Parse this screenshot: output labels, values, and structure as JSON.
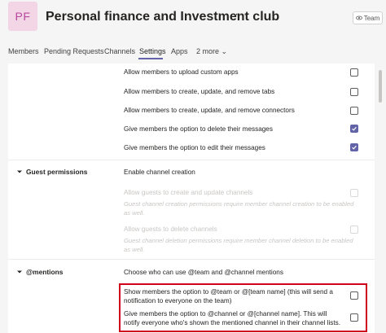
{
  "header": {
    "avatar_initials": "PF",
    "team_name": "Personal finance and Investment club",
    "more_label": "···",
    "badge_label": "Team"
  },
  "tabs": [
    {
      "label": "Members"
    },
    {
      "label": "Pending Requests"
    },
    {
      "label": "Channels"
    },
    {
      "label": "Settings",
      "active": true
    },
    {
      "label": "Apps"
    },
    {
      "label": "2 more ⌄"
    }
  ],
  "member_permissions": [
    {
      "label": "Allow members to upload custom apps",
      "checked": false
    },
    {
      "label": "Allow members to create, update, and remove tabs",
      "checked": false
    },
    {
      "label": "Allow members to create, update, and remove connectors",
      "checked": false
    },
    {
      "label": "Give members the option to delete their messages",
      "checked": true
    },
    {
      "label": "Give members the option to edit their messages",
      "checked": true
    }
  ],
  "guest_permissions": {
    "title": "Guest permissions",
    "subtitle": "Enable channel creation",
    "items": [
      {
        "label": "Allow guests to create and update channels",
        "note": "Guest channel creation permissions require member channel creation to be enabled as well.",
        "checked": false,
        "disabled": true
      },
      {
        "label": "Allow guests to delete channels",
        "note": "Guest channel deletion permissions require member channel deletion to be enabled as well.",
        "checked": false,
        "disabled": true
      }
    ]
  },
  "mentions": {
    "title": "@mentions",
    "subtitle": "Choose who can use @team and @channel mentions",
    "items": [
      {
        "label": "Show members the option to @team or @[team name] (this will send a notification to everyone on the team)",
        "checked": false
      },
      {
        "label": "Give members the option to @channel or @[channel name]. This will notify everyone who's shown the mentioned channel in their channel lists.",
        "checked": false
      }
    ]
  },
  "colors": {
    "accent": "#6264a7",
    "highlight_border": "#d0021b",
    "avatar_bg": "#f3d6e6",
    "avatar_text": "#b7479f"
  }
}
